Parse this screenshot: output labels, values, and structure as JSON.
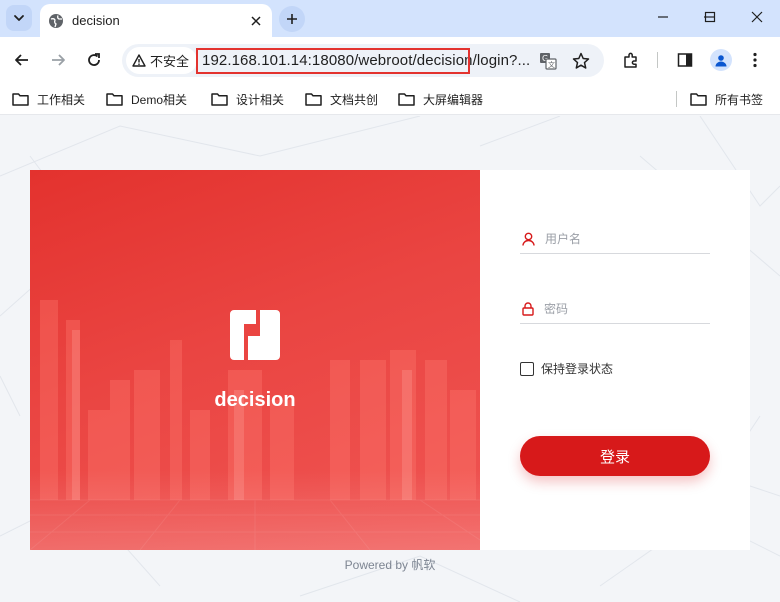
{
  "browser": {
    "tab_title": "decision",
    "security_label": "不安全",
    "url": "192.168.101.14:18080/webroot/decision/login?..."
  },
  "bookmarks": [
    {
      "label": "工作相关"
    },
    {
      "label": "Demo相关"
    },
    {
      "label": "设计相关"
    },
    {
      "label": "文档共创"
    },
    {
      "label": "大屏编辑器"
    }
  ],
  "all_bookmarks_label": "所有书签",
  "login": {
    "brand_name": "decision",
    "username_placeholder": "用户名",
    "password_placeholder": "密码",
    "remember_label": "保持登录状态",
    "remember_checked": false,
    "submit_label": "登录"
  },
  "footer": {
    "powered_by": "Powered by 帆软"
  },
  "colors": {
    "accent": "#d7191a",
    "url_highlight": "#e3332f",
    "browser_frame": "#d3e3fd"
  },
  "icons": [
    "globe-icon",
    "close-icon",
    "plus-icon",
    "back-arrow-icon",
    "forward-arrow-icon",
    "reload-icon",
    "warning-icon",
    "translate-icon",
    "star-icon",
    "extensions-icon",
    "side-panel-icon",
    "profile-icon",
    "menu-icon",
    "folder-icon",
    "user-icon",
    "lock-icon"
  ]
}
